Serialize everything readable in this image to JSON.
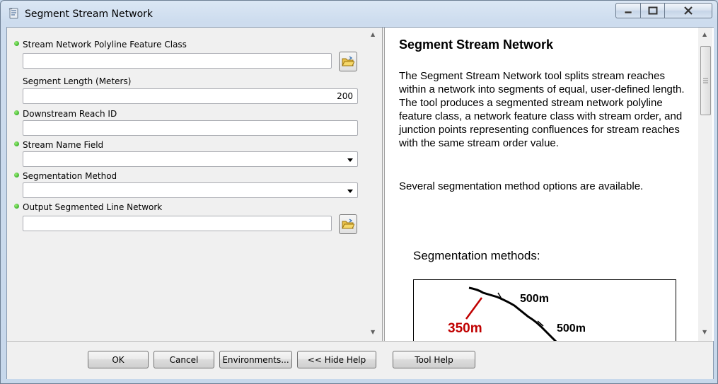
{
  "window": {
    "title": "Segment Stream Network"
  },
  "params": [
    {
      "label": "Stream Network Polyline Feature Class",
      "required": true,
      "type": "browse",
      "value": ""
    },
    {
      "label": "Segment Length (Meters)",
      "required": false,
      "type": "text",
      "value": "200"
    },
    {
      "label": "Downstream Reach ID",
      "required": true,
      "type": "text",
      "value": ""
    },
    {
      "label": "Stream Name Field",
      "required": true,
      "type": "dropdown",
      "value": ""
    },
    {
      "label": "Segmentation Method",
      "required": true,
      "type": "dropdown",
      "value": ""
    },
    {
      "label": "Output Segmented Line Network",
      "required": true,
      "type": "browse",
      "value": ""
    }
  ],
  "help": {
    "title": "Segment Stream Network",
    "body": "The Segment Stream Network tool splits stream reaches within a network into segments of equal, user-defined length. The tool produces a segmented stream network polyline feature class, a network feature class with stream order, and junction points representing confluences for stream reaches with the same stream order value.",
    "body2": "Several segmentation method options are available.",
    "caption": "Segmentation methods:",
    "diagram_labels": {
      "a": "500m",
      "b": "500m",
      "c": "350m"
    },
    "diagram_colors": {
      "highlight": "#c00000",
      "line": "#000000"
    }
  },
  "buttons": {
    "ok": "OK",
    "cancel": "Cancel",
    "environments": "Environments...",
    "hide_help": "<< Hide Help",
    "tool_help": "Tool Help"
  },
  "icons": {
    "title": "toolbox-script-icon",
    "browse": "open-folder-icon",
    "required": "green-dot-icon"
  }
}
